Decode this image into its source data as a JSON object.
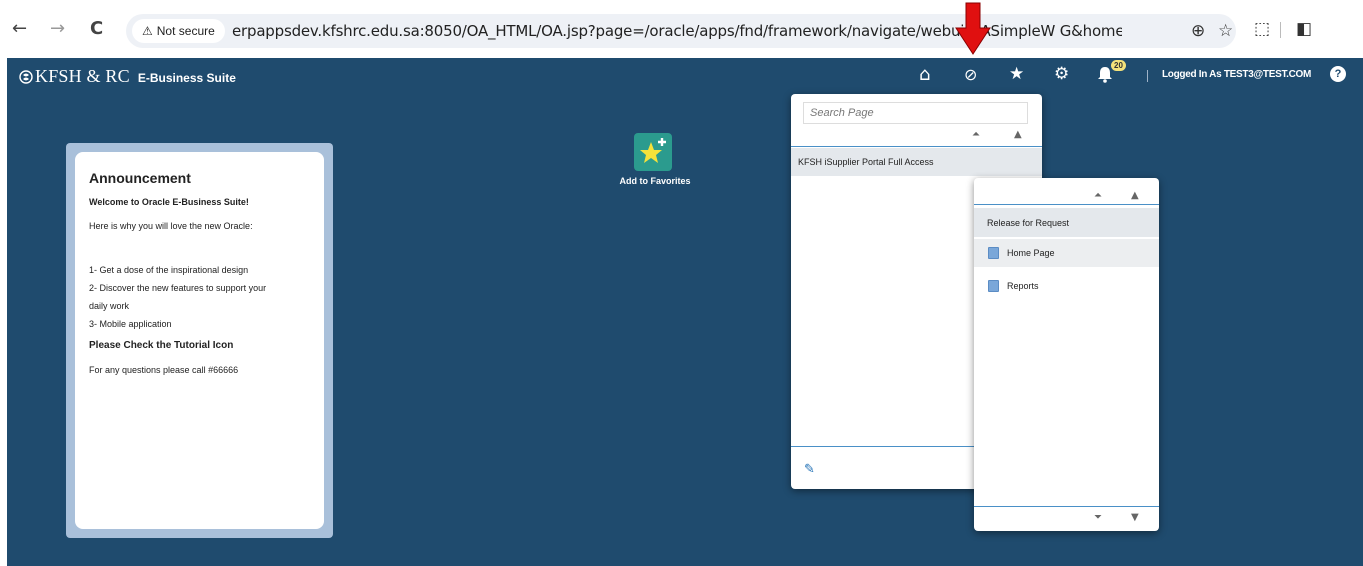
{
  "browser": {
    "back_icon": "←",
    "forward_icon": "→",
    "reload_icon": "C",
    "secure_icon": "⚠",
    "secure_label": "Not secure",
    "url": "erpappsdev.kfshrc.edu.sa:8050/OA_HTML/OA.jsp?page=/oracle/apps/fnd/framework/navigate/webui/OASimpleW  G&homePage=Y&OAPB...",
    "zoom_icon": "⊕",
    "star_icon": "☆",
    "extensions_icon": "⬚",
    "sidebar_icon": "◧"
  },
  "header": {
    "logo": "KFSH & RC",
    "suite": "E-Business Suite",
    "home_icon": "⌂",
    "navigator_icon": "⊘",
    "favorites_icon": "★",
    "settings_icon": "⚙",
    "bell_icon": "🔔",
    "notifications": "20",
    "logged_in": "Logged In As TEST3@TEST.COM",
    "help": "?"
  },
  "announcement": {
    "title": "Announcement",
    "welcome": "Welcome to Oracle E-Business Suite!",
    "intro": "Here is why you will love the new Oracle:",
    "items": [
      "1- Get a dose of the inspirational design",
      "2- Discover the new features to support your",
      "daily work",
      "3- Mobile application"
    ],
    "tutorial": "Please Check the Tutorial Icon",
    "contact": "For any questions please call #66666"
  },
  "favorites": {
    "label": "Add to Favorites"
  },
  "navigator": {
    "search_placeholder": "Search Page",
    "responsibility": "KFSH iSupplier Portal Full Access",
    "edit_icon": "✎",
    "submenu": {
      "header": "Release for Request",
      "items": [
        "Home Page",
        "Reports"
      ]
    }
  },
  "colors": {
    "app_bg": "#1f4b6e",
    "frame": "#a9c0da",
    "favorite_tile": "#2b9b8e",
    "annotation_arrow": "#e01010"
  }
}
